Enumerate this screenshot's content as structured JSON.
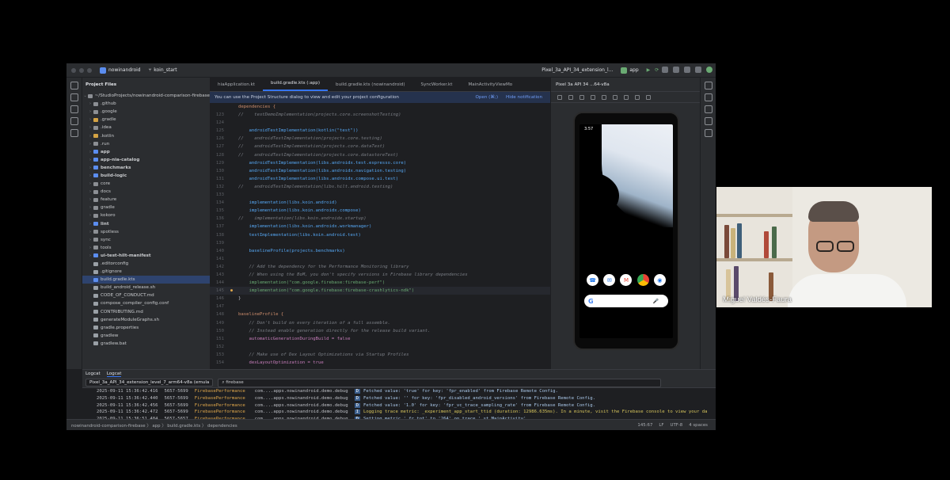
{
  "window": {
    "project": "nowinandroid",
    "branch": "koin_start",
    "device": "Pixel_3a_API_34_extension_l...",
    "run_config": "app"
  },
  "project_panel": {
    "title": "Project Files",
    "root": "~/StudioProjects/nowinandroid-comparison-firebase",
    "items": [
      {
        "label": ".github",
        "type": "folder",
        "color": "#8c8f94"
      },
      {
        "label": ".google",
        "type": "folder",
        "color": "#8c8f94"
      },
      {
        "label": ".gradle",
        "type": "folder",
        "color": "#d3a244"
      },
      {
        "label": ".idea",
        "type": "folder",
        "color": "#8c8f94"
      },
      {
        "label": ".kotlin",
        "type": "folder",
        "color": "#d3a244"
      },
      {
        "label": ".run",
        "type": "folder",
        "color": "#8c8f94"
      },
      {
        "label": "app",
        "type": "module",
        "color": "#5b8def"
      },
      {
        "label": "app-nia-catalog",
        "type": "module",
        "color": "#5b8def"
      },
      {
        "label": "benchmarks",
        "type": "module",
        "color": "#5b8def"
      },
      {
        "label": "build-logic",
        "type": "module",
        "color": "#5b8def"
      },
      {
        "label": "core",
        "type": "folder",
        "color": "#8c8f94"
      },
      {
        "label": "docs",
        "type": "folder",
        "color": "#8c8f94"
      },
      {
        "label": "feature",
        "type": "folder",
        "color": "#8c8f94"
      },
      {
        "label": "gradle",
        "type": "folder",
        "color": "#8c8f94"
      },
      {
        "label": "kokoro",
        "type": "folder",
        "color": "#8c8f94"
      },
      {
        "label": "lint",
        "type": "module",
        "color": "#5b8def"
      },
      {
        "label": "spotless",
        "type": "folder",
        "color": "#8c8f94"
      },
      {
        "label": "sync",
        "type": "folder",
        "color": "#8c8f94"
      },
      {
        "label": "tools",
        "type": "folder",
        "color": "#8c8f94"
      },
      {
        "label": "ui-test-hilt-manifest",
        "type": "module",
        "color": "#5b8def"
      },
      {
        "label": ".editorconfig",
        "type": "file",
        "color": "#9aa0a6"
      },
      {
        "label": ".gitignore",
        "type": "file",
        "color": "#9aa0a6"
      },
      {
        "label": "build.gradle.kts",
        "type": "file",
        "color": "#5b8def",
        "selected": true
      },
      {
        "label": "build_android_release.sh",
        "type": "file",
        "color": "#9aa0a6"
      },
      {
        "label": "CODE_OF_CONDUCT.md",
        "type": "file",
        "color": "#9aa0a6"
      },
      {
        "label": "compose_compiler_config.conf",
        "type": "file",
        "color": "#9aa0a6"
      },
      {
        "label": "CONTRIBUTING.md",
        "type": "file",
        "color": "#9aa0a6"
      },
      {
        "label": "generateModuleGraphs.sh",
        "type": "file",
        "color": "#9aa0a6"
      },
      {
        "label": "gradle.properties",
        "type": "file",
        "color": "#9aa0a6"
      },
      {
        "label": "gradlew",
        "type": "file",
        "color": "#9aa0a6"
      },
      {
        "label": "gradlew.bat",
        "type": "file",
        "color": "#9aa0a6"
      }
    ]
  },
  "editor": {
    "tabs": [
      {
        "label": "hiaApplication.kt",
        "active": false
      },
      {
        "label": "build.gradle.kts (:app)",
        "active": true
      },
      {
        "label": "build.gradle.kts (nowinandroid)",
        "active": false
      },
      {
        "label": "SyncWorker.kt",
        "active": false
      },
      {
        "label": "MainActivityViewMo",
        "active": false
      }
    ],
    "notice": {
      "text": "You can use the Project Structure dialog to view and edit your project configuration",
      "open": "Open (⌘;)",
      "hide": "Hide notification"
    },
    "lines": [
      {
        "n": "",
        "text": "dependencies {",
        "style": "kw"
      },
      {
        "n": "123",
        "text": "//    testDemoImplementation(projects.core.screenshotTesting)",
        "style": "cm"
      },
      {
        "n": "124",
        "text": "",
        "style": ""
      },
      {
        "n": "125",
        "text": "    androidTestImplementation(kotlin(\"test\"))",
        "style": "fn"
      },
      {
        "n": "126",
        "text": "//    androidTestImplementation(projects.core.testing)",
        "style": "cm"
      },
      {
        "n": "127",
        "text": "//    androidTestImplementation(projects.core.dataTest)",
        "style": "cm"
      },
      {
        "n": "128",
        "text": "//    androidTestImplementation(projects.core.datastoreTest)",
        "style": "cm"
      },
      {
        "n": "129",
        "text": "    androidTestImplementation(libs.androidx.test.espresso.core)",
        "style": "fn"
      },
      {
        "n": "130",
        "text": "    androidTestImplementation(libs.androidx.navigation.testing)",
        "style": "fn"
      },
      {
        "n": "131",
        "text": "    androidTestImplementation(libs.androidx.compose.ui.test)",
        "style": "fn"
      },
      {
        "n": "132",
        "text": "//    androidTestImplementation(libs.hilt.android.testing)",
        "style": "cm"
      },
      {
        "n": "133",
        "text": "",
        "style": ""
      },
      {
        "n": "134",
        "text": "    implementation(libs.koin.android)",
        "style": "fn"
      },
      {
        "n": "135",
        "text": "    implementation(libs.koin.androidx.compose)",
        "style": "fn"
      },
      {
        "n": "136",
        "text": "//    implementation(libs.koin.androidx.startup)",
        "style": "cm"
      },
      {
        "n": "137",
        "text": "    implementation(libs.koin.androidx.workmanager)",
        "style": "fn"
      },
      {
        "n": "138",
        "text": "    testImplementation(libs.koin.android.test)",
        "style": "fn"
      },
      {
        "n": "139",
        "text": "",
        "style": ""
      },
      {
        "n": "140",
        "text": "    baselineProfile(projects.benchmarks)",
        "style": "fn"
      },
      {
        "n": "141",
        "text": "",
        "style": ""
      },
      {
        "n": "142",
        "text": "    // Add the dependency for the Performance Monitoring library",
        "style": "cm"
      },
      {
        "n": "143",
        "text": "    // When using the BoM, you don't specify versions in Firebase library dependencies",
        "style": "cm"
      },
      {
        "n": "144",
        "text": "    implementation(\"com.google.firebase:firebase-perf\")",
        "style": "str"
      },
      {
        "n": "145",
        "text": "    implementation(\"com.google.firebase:firebase-crashlytics-ndk\")",
        "style": "str",
        "current": true
      },
      {
        "n": "146",
        "text": "}",
        "style": ""
      },
      {
        "n": "147",
        "text": "",
        "style": ""
      },
      {
        "n": "148",
        "text": "baselineProfile {",
        "style": "kw"
      },
      {
        "n": "149",
        "text": "    // Don't build on every iteration of a full assemble.",
        "style": "cm"
      },
      {
        "n": "150",
        "text": "    // Instead enable generation directly for the release build variant.",
        "style": "cm"
      },
      {
        "n": "151",
        "text": "    automaticGenerationDuringBuild = false",
        "style": "prop"
      },
      {
        "n": "152",
        "text": "",
        "style": ""
      },
      {
        "n": "153",
        "text": "    // Make use of Dex Layout Optimizations via Startup Profiles",
        "style": "cm"
      },
      {
        "n": "154",
        "text": "    dexLayoutOptimization = true",
        "style": "prop"
      }
    ]
  },
  "emulator": {
    "title": "Pixel 3a API 34 ...64-v8a",
    "phone_time": "3:57",
    "search_logo": "G"
  },
  "logcat": {
    "tab1": "Logcat",
    "tab2": "Logcat",
    "device": "Pixel_3a_API_34_extension_level_7_arm64-v8a (emula",
    "filter": "firebase",
    "rows": [
      {
        "ts": "2025-09-11 15:36:42.416",
        "pid": "5657-5699",
        "tag": "FirebasePerformance",
        "pkg": "com....apps.nowinandroid.demo.debug",
        "lvl": "D",
        "msg": "Fetched value: 'true' for key: 'fpr_enabled' from Firebase Remote Config."
      },
      {
        "ts": "2025-09-11 15:36:42.440",
        "pid": "5657-5699",
        "tag": "FirebasePerformance",
        "pkg": "com....apps.nowinandroid.demo.debug",
        "lvl": "D",
        "msg": "Fetched value: '' for key: 'fpr_disabled_android_versions' from Firebase Remote Config."
      },
      {
        "ts": "2025-09-11 15:36:42.456",
        "pid": "5657-5699",
        "tag": "FirebasePerformance",
        "pkg": "com....apps.nowinandroid.demo.debug",
        "lvl": "D",
        "msg": "Fetched value: '1.0' for key: 'fpr_vc_trace_sampling_rate' from Firebase Remote Config."
      },
      {
        "ts": "2025-09-11 15:36:42.472",
        "pid": "5657-5699",
        "tag": "FirebasePerformance",
        "pkg": "com....apps.nowinandroid.demo.debug",
        "lvl": "I",
        "msg": "Logging trace metric: _experiment_app_start_ttid (duration: 12986.635ms). In a minute, visit the Firebase console to view your da"
      },
      {
        "ts": "2025-09-11 15:36:51.484",
        "pid": "5657-5657",
        "tag": "FirebasePerformance",
        "pkg": "com....apps.nowinandroid.demo.debug",
        "lvl": "D",
        "msg": "Setting metric '_fr_tot' to '264' on trace '_st_MainActivity'"
      }
    ]
  },
  "statusbar": {
    "breadcrumb": "nowinandroid-comparison-firebase 〉 app 〉 build.gradle.kts 〉 dependencies",
    "position": "145:67",
    "line_sep": "LF",
    "encoding": "UTF-8",
    "indent": "4 spaces"
  },
  "webcam": {
    "name": "Miguel Valdés-Faura"
  }
}
